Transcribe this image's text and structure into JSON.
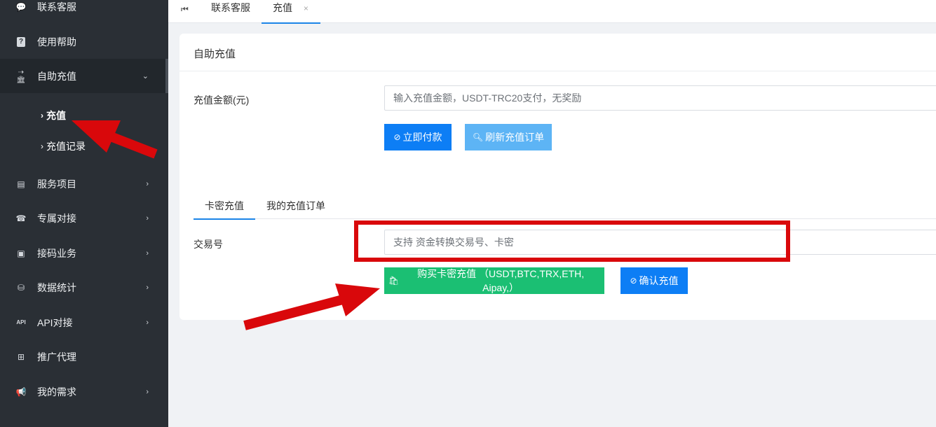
{
  "sidebar": {
    "items": [
      {
        "label": "联系客服",
        "icon": "chat-bubble-icon",
        "glyph": "💬"
      },
      {
        "label": "使用帮助",
        "icon": "help-icon",
        "glyph": "?"
      },
      {
        "label": "自助充值",
        "icon": "bank-icon",
        "glyph": "⇢🏛"
      },
      {
        "label": "服务项目",
        "icon": "list-card-icon",
        "glyph": "▤"
      },
      {
        "label": "专属对接",
        "icon": "phone-icon",
        "glyph": "☎"
      },
      {
        "label": "接码业务",
        "icon": "sms-icon",
        "glyph": "▣"
      },
      {
        "label": "数据统计",
        "icon": "database-icon",
        "glyph": "⛁"
      },
      {
        "label": "API对接",
        "icon": "api-icon",
        "glyph": "API"
      },
      {
        "label": "推广代理",
        "icon": "sitemap-icon",
        "glyph": "⊞"
      },
      {
        "label": "我的需求",
        "icon": "megaphone-icon",
        "glyph": "📢"
      }
    ],
    "sub_items": [
      {
        "label": "充值"
      },
      {
        "label": "充值记录"
      }
    ]
  },
  "tabs": {
    "nav_glyph": "⏮",
    "items": [
      {
        "label": "联系客服"
      },
      {
        "label": "充值",
        "close": "×"
      }
    ]
  },
  "card": {
    "title": "自助充值",
    "amount_label": "充值金额(元)",
    "amount_placeholder": "输入充值金额，USDT-TRC20支付，无奖励",
    "pay_button": "立即付款",
    "refresh_button": "刷新充值订单",
    "tabs": [
      {
        "label": "卡密充值"
      },
      {
        "label": "我的充值订单"
      }
    ],
    "txn_label": "交易号",
    "txn_placeholder": "支持 资金转换交易号、卡密",
    "buy_card_button": "购买卡密充值 （USDT,BTC,TRX,ETH, Aipay,）",
    "confirm_button": "确认充值"
  },
  "colors": {
    "sidebar_bg": "#2a2f35",
    "primary": "#0d7ef5",
    "light_primary": "#5db4f5",
    "success": "#1bbf73",
    "annotation_red": "#d9080b"
  }
}
